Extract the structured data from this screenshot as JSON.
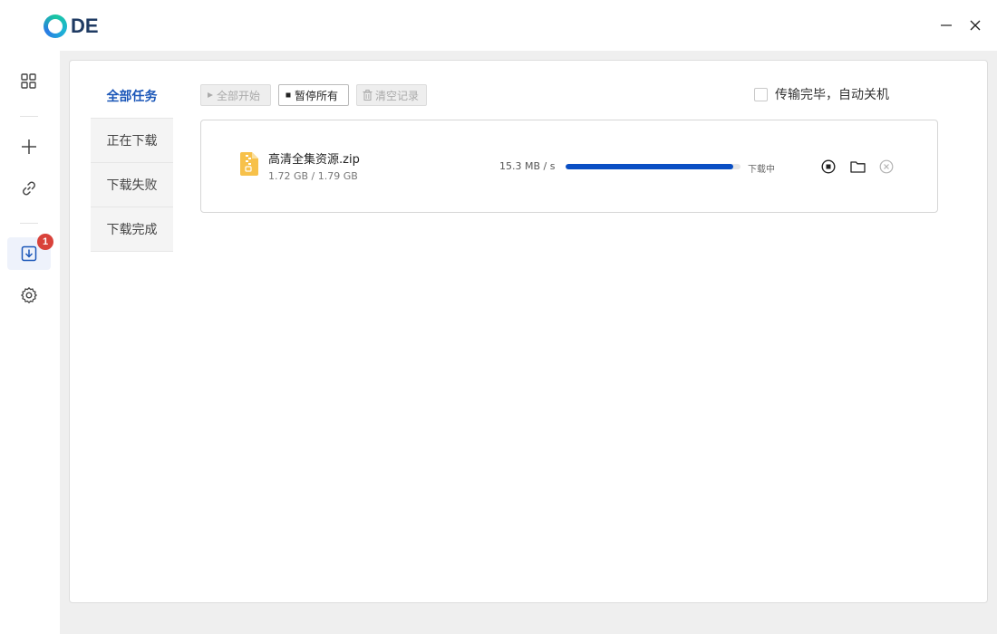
{
  "app": {
    "logo_text": "DE",
    "window_controls": {
      "minimize": "−",
      "close": "✕"
    },
    "colors": {
      "accent": "#1a56b8",
      "progress": "#0a4fc4",
      "badge": "#d9423a"
    }
  },
  "sidebar": {
    "items": [
      {
        "name": "apps-grid-icon"
      },
      {
        "name": "add-task-icon"
      },
      {
        "name": "link-icon"
      },
      {
        "name": "downloads-icon",
        "badge": "1",
        "active": true
      },
      {
        "name": "settings-gear-icon"
      }
    ]
  },
  "tabs": [
    {
      "label": "全部任务",
      "active": true
    },
    {
      "label": "正在下载"
    },
    {
      "label": "下载失败"
    },
    {
      "label": "下载完成"
    }
  ],
  "toolbar": {
    "start_all": "全部开始",
    "pause_all": "暂停所有",
    "clear_records": "清空记录"
  },
  "auto_shutdown_label": "传输完毕，自动关机",
  "downloads": [
    {
      "file_name": "高清全集资源.zip",
      "size_text": "1.72 GB / 1.79 GB",
      "speed": "15.3 MB / s",
      "progress": 0.96,
      "status": "下载中"
    }
  ]
}
